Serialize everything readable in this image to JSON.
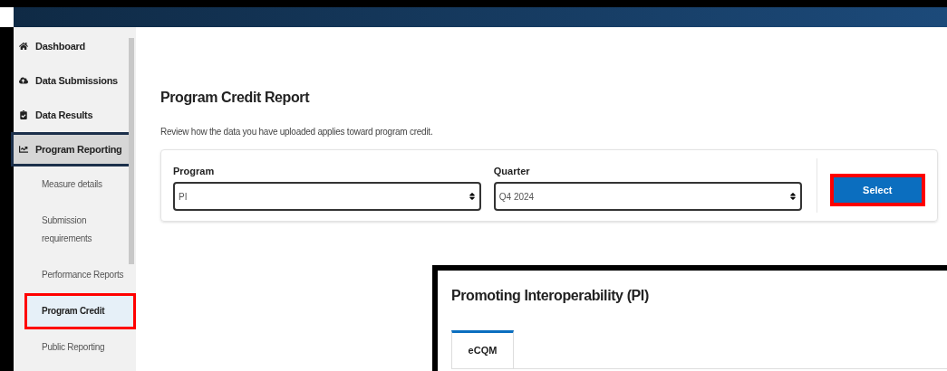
{
  "sidebar": {
    "items": [
      {
        "label": "Dashboard",
        "kind": "main",
        "selected": false,
        "highlighted": false
      },
      {
        "label": "Data Submissions",
        "kind": "main",
        "selected": false,
        "highlighted": false
      },
      {
        "label": "Data Results",
        "kind": "main",
        "selected": false,
        "highlighted": false
      },
      {
        "label": "Program Reporting",
        "kind": "main",
        "selected": true,
        "highlighted": false
      },
      {
        "label": "Measure details",
        "kind": "sub",
        "selected": false,
        "highlighted": false
      },
      {
        "label": "Submission requirements",
        "kind": "sub",
        "selected": false,
        "highlighted": false
      },
      {
        "label": "Performance Reports",
        "kind": "sub",
        "selected": false,
        "highlighted": false
      },
      {
        "label": "Program Credit",
        "kind": "sub",
        "selected": true,
        "highlighted": true
      },
      {
        "label": "Public Reporting",
        "kind": "sub",
        "selected": false,
        "highlighted": false
      }
    ]
  },
  "page": {
    "title": "Program Credit Report",
    "description": "Review how the data you have uploaded applies toward program credit."
  },
  "filters": [
    {
      "label": "Program",
      "value": "PI"
    },
    {
      "label": "Quarter",
      "value": "Q4 2024"
    }
  ],
  "select_button": {
    "label": "Select",
    "highlighted": true
  },
  "inset": {
    "title": "Promoting Interoperability (PI)",
    "tabs": [
      {
        "label": "eCQM",
        "selected": true
      }
    ]
  }
}
